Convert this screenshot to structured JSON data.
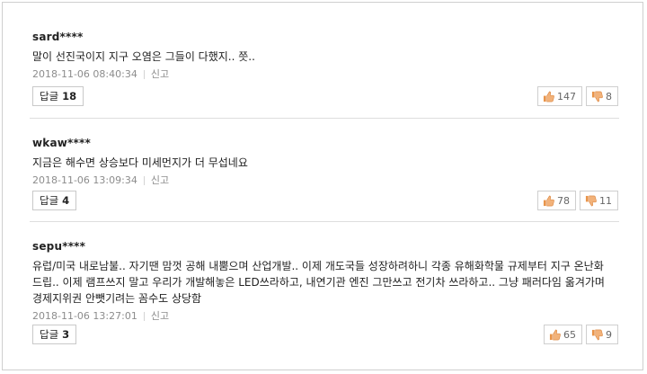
{
  "comments": [
    {
      "user": "sard****",
      "text": "말이 선진국이지 지구 오염은 그들이 다했지.. 쯧..",
      "date": "2018-11-06 08:40:34",
      "report": "신고",
      "reply_label": "답글",
      "reply_count": "18",
      "likes": "147",
      "dislikes": "8"
    },
    {
      "user": "wkaw****",
      "text": "지금은 해수면 상승보다 미세먼지가 더 무섭네요",
      "date": "2018-11-06 13:09:34",
      "report": "신고",
      "reply_label": "답글",
      "reply_count": "4",
      "likes": "78",
      "dislikes": "11"
    },
    {
      "user": "sepu****",
      "text": "유럽/미국 내로남불.. 자기땐 맘껏 공해 내뿜으며 산업개발.. 이제 개도국들 성장하려하니 각종 유해화학물 규제부터 지구 온난화 드립.. 이제 램프쓰지 말고 우리가 개발해놓은 LED쓰라하고, 내연기관 엔진 그만쓰고 전기차 쓰라하고.. 그냥 패러다임 옮겨가며 경제지위권 안뺏기려는 꼼수도 상당함",
      "date": "2018-11-06 13:27:01",
      "report": "신고",
      "reply_label": "답글",
      "reply_count": "3",
      "likes": "65",
      "dislikes": "9"
    }
  ],
  "icons": {
    "like": "thumbs-up-icon",
    "dislike": "thumbs-down-icon",
    "like_color": "#e8944a",
    "dislike_color": "#e8944a"
  }
}
